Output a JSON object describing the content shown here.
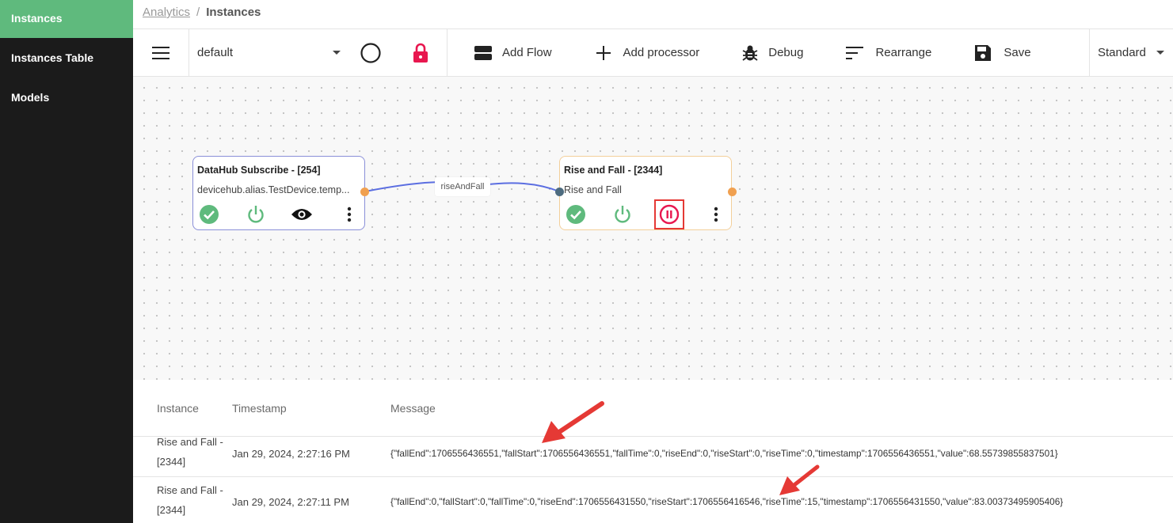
{
  "sidebar": {
    "items": [
      {
        "label": "Instances",
        "active": true
      },
      {
        "label": "Instances Table",
        "active": false
      },
      {
        "label": "Models",
        "active": false
      }
    ]
  },
  "breadcrumb": {
    "parent": "Analytics",
    "separator": "/",
    "current": "Instances"
  },
  "toolbar": {
    "flow_select_value": "default",
    "add_flow": "Add Flow",
    "add_processor": "Add processor",
    "debug": "Debug",
    "rearrange": "Rearrange",
    "save": "Save",
    "view_select_value": "Standard"
  },
  "flow": {
    "nodes": [
      {
        "title": "DataHub Subscribe - [254]",
        "subtitle": "devicehub.alias.TestDevice.temp...",
        "border_color": "#8a8fd8"
      },
      {
        "title": "Rise and Fall - [2344]",
        "subtitle": "Rise and Fall",
        "border_color": "#f3cf9a"
      }
    ],
    "edge_label": "riseAndFall"
  },
  "messages": {
    "headers": {
      "instance": "Instance",
      "timestamp": "Timestamp",
      "message": "Message"
    },
    "rows": [
      {
        "instance_line1": "Rise and Fall -",
        "instance_line2": "[2344]",
        "timestamp": "Jan 29, 2024, 2:27:16 PM",
        "message": "{\"fallEnd\":1706556436551,\"fallStart\":1706556436551,\"fallTime\":0,\"riseEnd\":0,\"riseStart\":0,\"riseTime\":0,\"timestamp\":1706556436551,\"value\":68.55739855837501}"
      },
      {
        "instance_line1": "Rise and Fall -",
        "instance_line2": "[2344]",
        "timestamp": "Jan 29, 2024, 2:27:11 PM",
        "message": "{\"fallEnd\":0,\"fallStart\":0,\"fallTime\":0,\"riseEnd\":1706556431550,\"riseStart\":1706556416546,\"riseTime\":15,\"timestamp\":1706556431550,\"value\":83.00373495905406}"
      }
    ]
  },
  "colors": {
    "sidebar_bg": "#1b1b1b",
    "sidebar_active": "#5fba7d",
    "lock_red": "#e8174f",
    "status_green": "#5fba7d",
    "edge_blue": "#5b6ee1",
    "port_orange": "#f0a050",
    "port_dark": "#4d6b7f",
    "annotation_red": "#e53935"
  }
}
